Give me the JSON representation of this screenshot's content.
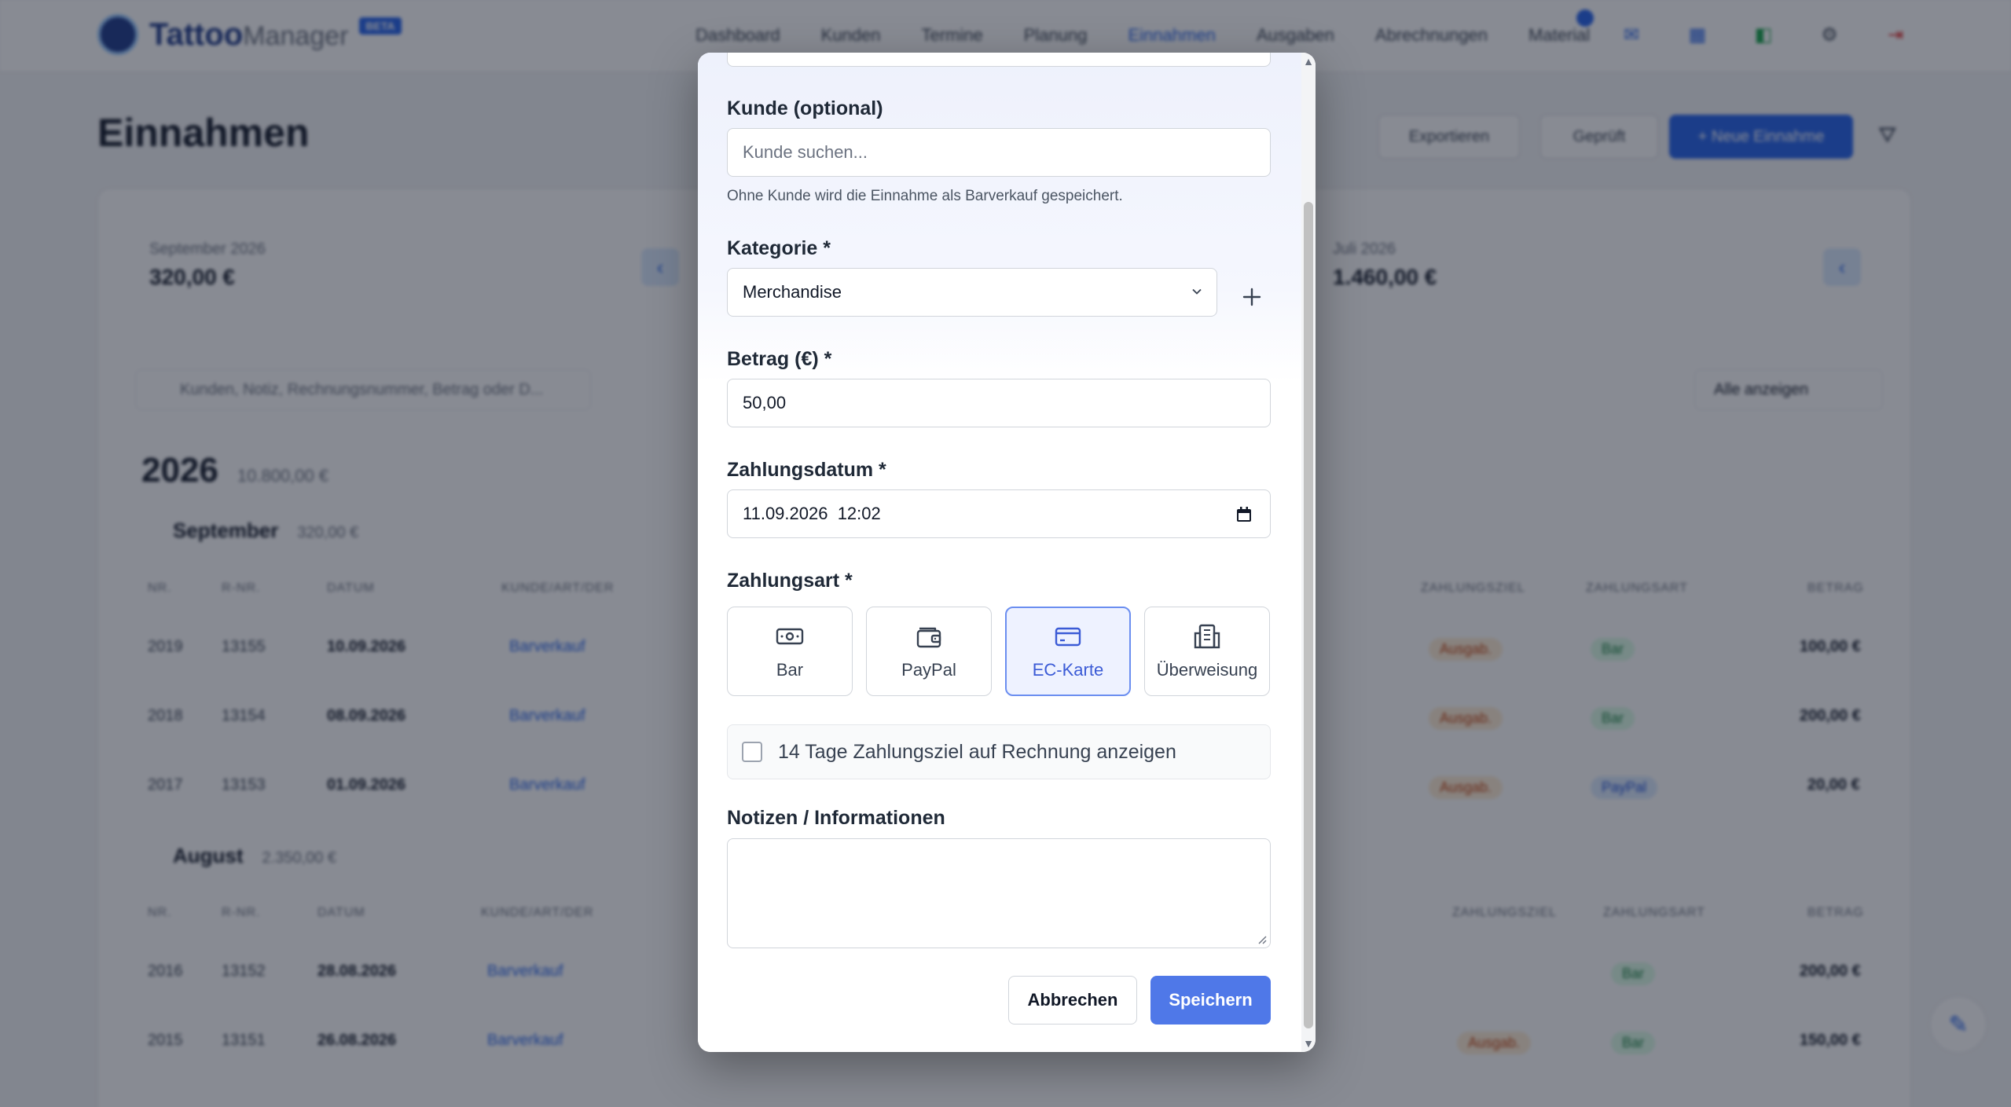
{
  "app": {
    "logo_main": "Tattoo",
    "logo_sub": "Manager",
    "logo_badge": "BETA",
    "nav": [
      "Dashboard",
      "Kunden",
      "Termine",
      "Planung",
      "Einnahmen",
      "Ausgaben",
      "Abrechnungen",
      "Material"
    ],
    "active_nav": "Einnahmen"
  },
  "page": {
    "title": "Einnahmen",
    "btn_export": "Exportieren",
    "btn_checked": "Geprüft",
    "btn_new": "+ Neue Einnahme"
  },
  "stats": [
    {
      "label": "September 2026",
      "value": "320,00 €"
    },
    {
      "label": "Juli 2026",
      "value": "1.460,00 €"
    }
  ],
  "filters": {
    "search_placeholder": "Kunden, Notiz, Rechnungsnummer, Betrag oder D...",
    "select_value": "Alle anzeigen"
  },
  "year": {
    "label": "2026",
    "sum": "10.800,00 €"
  },
  "months": [
    {
      "label": "September",
      "sum": "320,00 €"
    },
    {
      "label": "August",
      "sum": "2.350,00 €"
    }
  ],
  "table": {
    "headers": [
      "NR.",
      "R-NR.",
      "DATUM",
      "KUNDE/ART/DER",
      "ZAHLUNGSZIEL",
      "ZAHLUNGSART",
      "BETRAG"
    ],
    "rows": [
      {
        "nr": "2019",
        "rnr": "13155",
        "date": "10.09.2026",
        "kunde": "Barverkauf",
        "status": "Ausgab.",
        "zahlart": "Bar",
        "betrag": "100,00 €"
      },
      {
        "nr": "2018",
        "rnr": "13154",
        "date": "08.09.2026",
        "kunde": "Barverkauf",
        "status": "Ausgab.",
        "zahlart": "Bar",
        "betrag": "200,00 €"
      },
      {
        "nr": "2017",
        "rnr": "13153",
        "date": "01.09.2026",
        "kunde": "Barverkauf",
        "status": "Ausgab.",
        "zahlart": "PayPal",
        "betrag": "20,00 €"
      }
    ],
    "rows_aug": [
      {
        "nr": "2016",
        "rnr": "13152",
        "date": "28.08.2026",
        "kunde": "Barverkauf",
        "zahlart": "Bar",
        "betrag": "200,00 €"
      },
      {
        "nr": "2015",
        "rnr": "13151",
        "date": "26.08.2026",
        "kunde": "Barverkauf",
        "status": "Ausgab.",
        "zahlart": "Bar",
        "betrag": "150,00 €"
      }
    ]
  },
  "modal": {
    "customer": {
      "label": "Kunde (optional)",
      "placeholder": "Kunde suchen...",
      "help": "Ohne Kunde wird die Einnahme als Barverkauf gespeichert."
    },
    "category": {
      "label": "Kategorie *",
      "value": "Merchandise"
    },
    "amount": {
      "label": "Betrag (€) *",
      "value": "50,00"
    },
    "date": {
      "label": "Zahlungsdatum *",
      "value": "11.09.2026  12:02"
    },
    "payment": {
      "label": "Zahlungsart *",
      "options": [
        {
          "label": "Bar",
          "icon": "cash-icon"
        },
        {
          "label": "PayPal",
          "icon": "wallet-icon"
        },
        {
          "label": "EC-Karte",
          "icon": "credit-card-icon"
        },
        {
          "label": "Überweisung",
          "icon": "bank-transfer-icon"
        }
      ],
      "selected": "EC-Karte"
    },
    "invoice_terms": {
      "label": "14 Tage Zahlungsziel auf Rechnung anzeigen",
      "checked": false
    },
    "notes": {
      "label": "Notizen / Informationen",
      "value": ""
    },
    "cancel_label": "Abbrechen",
    "save_label": "Speichern"
  },
  "colors": {
    "primary": "#4f78e8",
    "selected_bg": "#eef2ff",
    "selected_border": "#6b8ef0",
    "overlay": "#111827"
  }
}
